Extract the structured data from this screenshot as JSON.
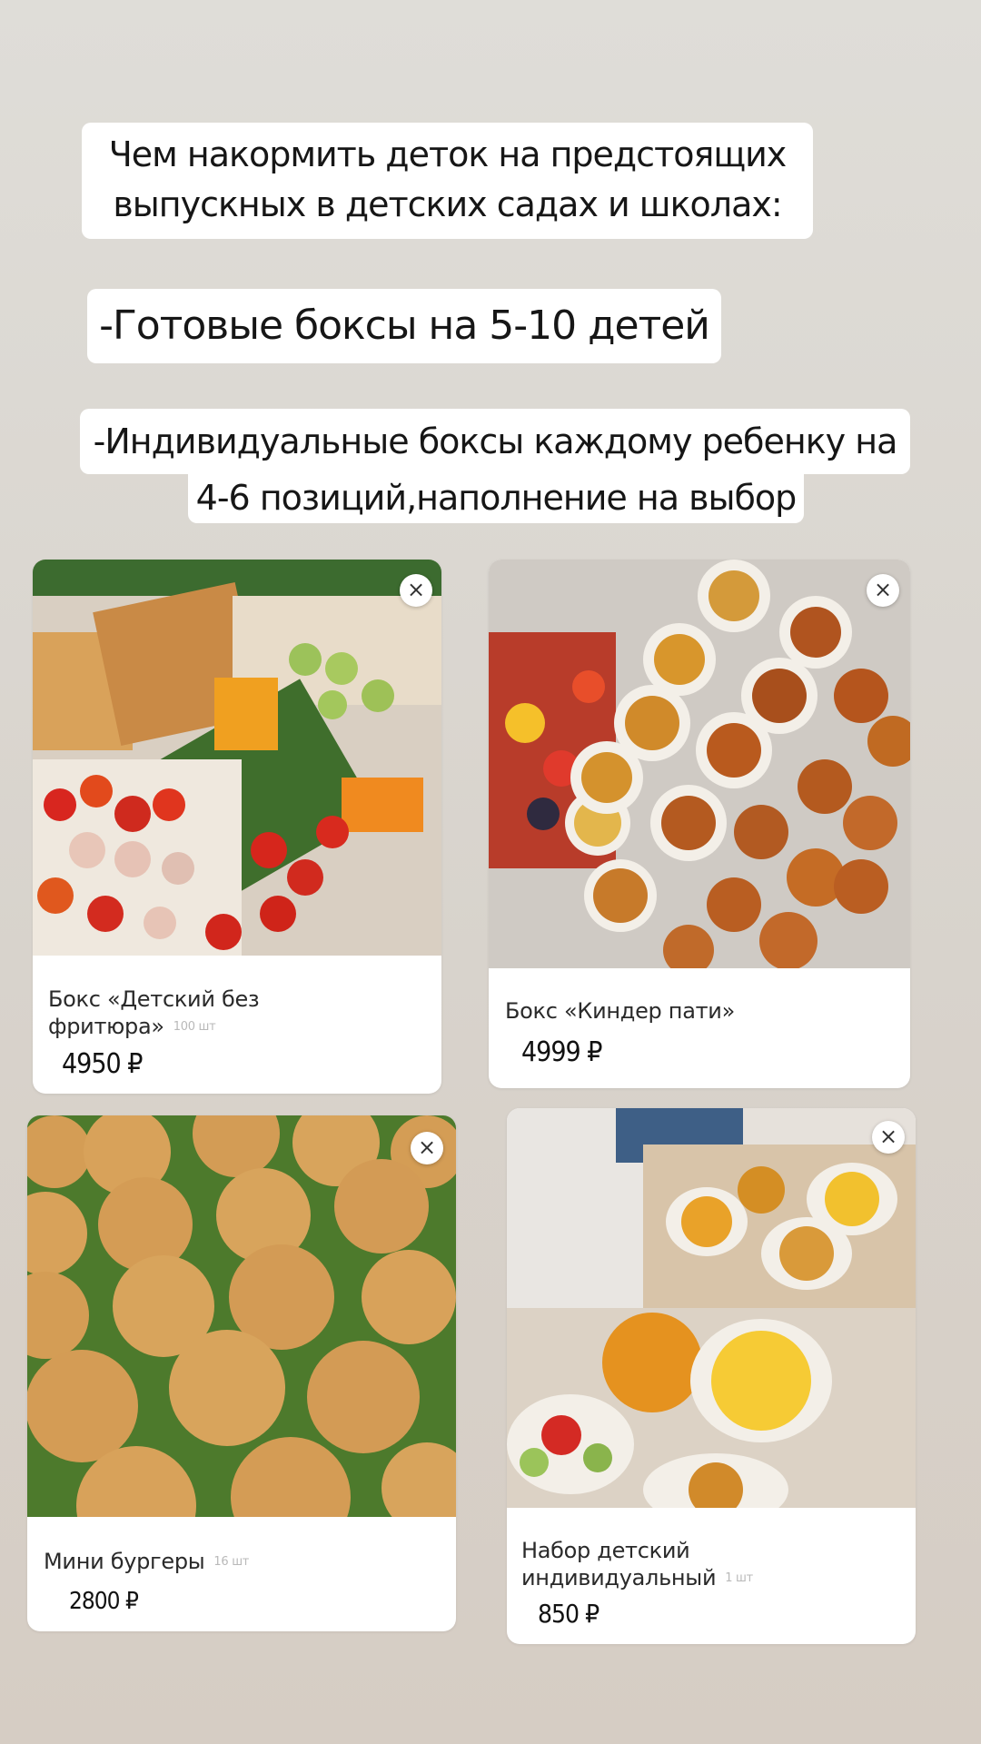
{
  "headline": {
    "line1": "Чем накормить деток на предстоящих",
    "line2": "выпускных в детских садах и школах:"
  },
  "option1": "-Готовые боксы на 5-10 детей",
  "option2": {
    "line1": "-Индивидуальные боксы каждому ребенку на",
    "line2": "4-6 позиций,наполнение на выбор"
  },
  "products": [
    {
      "title_line1": "Бокс «Детский без",
      "title_line2": "фритюра»",
      "qty": "100 шт",
      "price": "4950 ₽"
    },
    {
      "title": "Бокс «Киндер пати»",
      "price": "4999 ₽"
    },
    {
      "title": "Мини бургеры",
      "qty": "16 шт",
      "price": "2800 ₽"
    },
    {
      "title_line1": "Набор детский",
      "title_line2": "индивидуальный",
      "qty": "1 шт",
      "price": "850 ₽"
    }
  ],
  "icons": {
    "close": "close-icon"
  },
  "colors": {
    "background": "#dad6d0",
    "card": "#ffffff",
    "text": "#161616"
  }
}
